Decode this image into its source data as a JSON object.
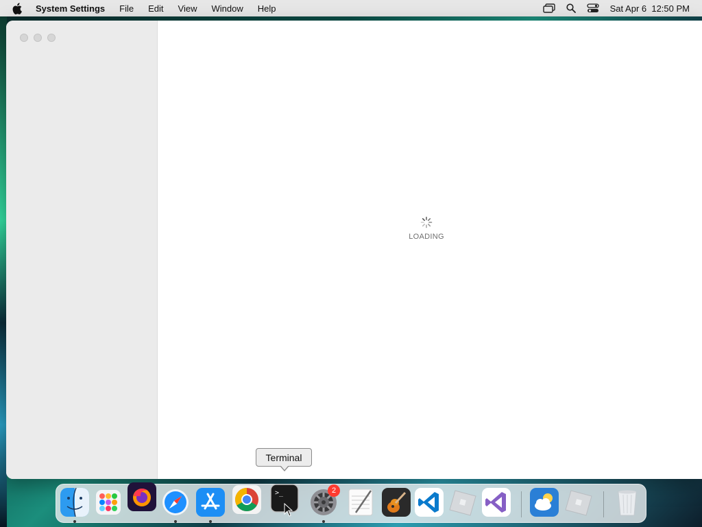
{
  "menubar": {
    "app_name": "System Settings",
    "items": [
      "File",
      "Edit",
      "View",
      "Window",
      "Help"
    ],
    "status_icons": [
      "screen-mirroring-icon",
      "search-icon",
      "control-center-icon"
    ],
    "clock": "Sat Apr 6  12:50 PM"
  },
  "window": {
    "loading_text": "LOADING"
  },
  "tooltip": {
    "label": "Terminal"
  },
  "dock": {
    "apps": [
      {
        "name": "Finder",
        "icon": "finder-icon",
        "running": true
      },
      {
        "name": "Launchpad",
        "icon": "launchpad-icon",
        "running": false
      },
      {
        "name": "Firefox",
        "icon": "firefox-icon",
        "running": false
      },
      {
        "name": "Safari",
        "icon": "safari-icon",
        "running": true
      },
      {
        "name": "App Store",
        "icon": "app-store-icon",
        "running": true
      },
      {
        "name": "Chrome",
        "icon": "chrome-icon",
        "running": false
      },
      {
        "name": "Terminal",
        "icon": "terminal-icon",
        "running": false
      },
      {
        "name": "System Settings",
        "icon": "system-settings-icon",
        "running": true,
        "badge": "2"
      },
      {
        "name": "TextEdit",
        "icon": "textedit-icon",
        "running": false
      },
      {
        "name": "GarageBand",
        "icon": "garageband-icon",
        "running": false
      },
      {
        "name": "Visual Studio Code",
        "icon": "vscode-icon",
        "running": false
      },
      {
        "name": "Roblox",
        "icon": "roblox-icon",
        "running": false
      },
      {
        "name": "Visual Studio",
        "icon": "visual-studio-icon",
        "running": false
      },
      {
        "name": "Weather",
        "icon": "weather-icon",
        "running": false
      },
      {
        "name": "Roblox Studio",
        "icon": "roblox-studio-icon",
        "running": false
      },
      {
        "name": "Trash",
        "icon": "trash-icon",
        "running": false
      }
    ]
  }
}
